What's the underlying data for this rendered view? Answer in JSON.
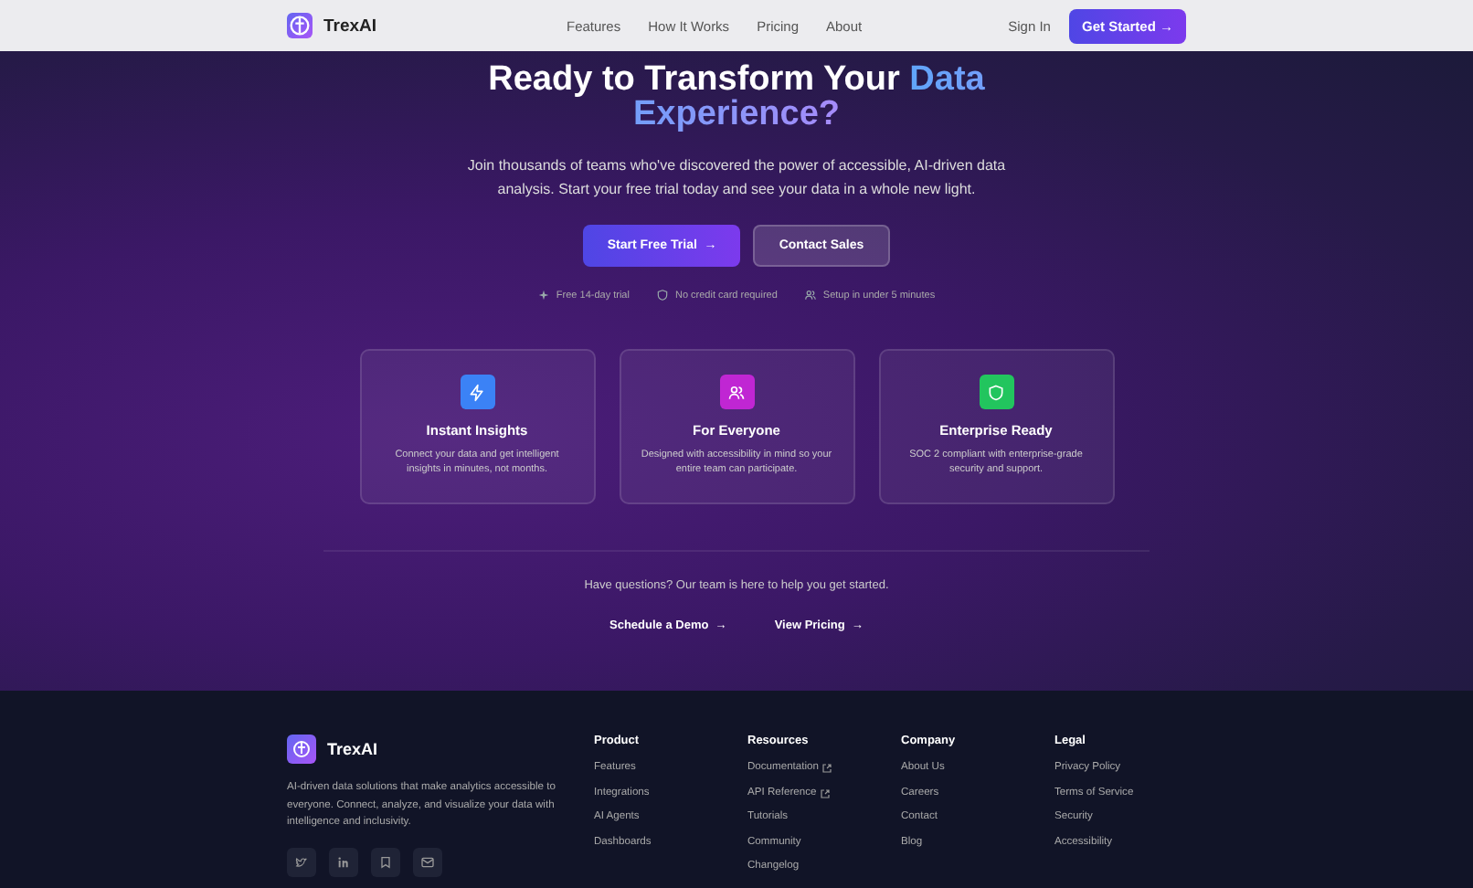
{
  "nav": {
    "brand": "TrexAI",
    "links": [
      "Features",
      "How It Works",
      "Pricing",
      "About"
    ],
    "sign_in": "Sign In",
    "cta": "Get Started",
    "cta_arrow": "→"
  },
  "hero": {
    "title": "Ready to Transform Your",
    "title_highlight": "Data Experience?",
    "subtitle": "Join thousands of teams who've discovered the power of accessible, AI-driven data analysis. Start your free trial today and see your data in a whole new light.",
    "buttons": [
      {
        "label": "Start Free Trial",
        "arrow": "→",
        "kind": "primary"
      },
      {
        "label": "Contact Sales",
        "kind": "secondary"
      }
    ],
    "perks": [
      {
        "text": "Free 14-day trial"
      },
      {
        "text": "No credit card required"
      },
      {
        "text": "Setup in under 5 minutes"
      }
    ],
    "features": [
      {
        "color": "#3b82f6",
        "title": "Instant Insights",
        "text": "Connect your data and get intelligent insights in minutes, not months."
      },
      {
        "color": "#c026d3",
        "title": "For Everyone",
        "text": "Designed with accessibility in mind so your entire team can participate."
      },
      {
        "color": "#22c55e",
        "title": "Enterprise Ready",
        "text": "SOC 2 compliant with enterprise-grade security and support."
      }
    ],
    "question": "Have questions? Our team is here to help you get started.",
    "links": [
      {
        "label": "Schedule a Demo",
        "arrow": "→"
      },
      {
        "label": "View Pricing",
        "arrow": "→"
      }
    ]
  },
  "footer": {
    "brand": "TrexAI",
    "tagline": "AI-driven data solutions that make analytics accessible to everyone. Connect, analyze, and visualize your data with intelligence and inclusivity.",
    "columns": [
      {
        "title": "Product",
        "links": [
          {
            "label": "Features",
            "external": false
          },
          {
            "label": "Integrations",
            "external": false
          },
          {
            "label": "AI Agents",
            "external": false
          },
          {
            "label": "Dashboards",
            "external": false
          }
        ]
      },
      {
        "title": "Resources",
        "links": [
          {
            "label": "Documentation",
            "external": true
          },
          {
            "label": "API Reference",
            "external": true
          },
          {
            "label": "Tutorials",
            "external": false
          },
          {
            "label": "Community",
            "external": false
          },
          {
            "label": "Changelog",
            "external": false
          }
        ]
      },
      {
        "title": "Company",
        "links": [
          {
            "label": "About Us",
            "external": false
          },
          {
            "label": "Careers",
            "external": false
          },
          {
            "label": "Contact",
            "external": false
          },
          {
            "label": "Blog",
            "external": false
          }
        ]
      },
      {
        "title": "Legal",
        "links": [
          {
            "label": "Privacy Policy",
            "external": false
          },
          {
            "label": "Terms of Service",
            "external": false
          },
          {
            "label": "Security",
            "external": false
          },
          {
            "label": "Accessibility",
            "external": false
          }
        ]
      }
    ]
  }
}
